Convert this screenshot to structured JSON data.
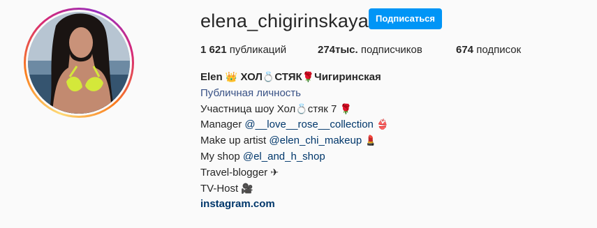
{
  "profile": {
    "username": "elena_chigirinskaya",
    "follow_label": "Подписаться"
  },
  "stats": {
    "posts_count": "1 621",
    "posts_label": " публикаций",
    "followers_count": "274тыс.",
    "followers_label": " подписчиков",
    "following_count": "674",
    "following_label": " подписок"
  },
  "bio": {
    "name_prefix": "Elen ",
    "name_emoji_1": "👑",
    "name_mid_1": " ХОЛ",
    "name_emoji_2": "💍",
    "name_mid_2": "СТЯК",
    "name_emoji_3": "🌹",
    "name_suffix": "Чигиринская",
    "category": "Публичная личность",
    "line1_text": "Участница шоу Хол",
    "line1_emoji_1": "💍",
    "line1_text_2": "стяк 7 ",
    "line1_emoji_2": "🌹",
    "line2_text": "Manager ",
    "line2_mention": "@__love__rose__collection",
    "line2_emoji": "👙",
    "line3_text": "Make up artist ",
    "line3_mention": "@elen_chi_makeup",
    "line3_emoji": "💄",
    "line4_text": "My shop ",
    "line4_mention": "@el_and_h_shop",
    "line5_text": "Travel-blogger ",
    "line5_emoji": "✈",
    "line6_text": "TV-Host ",
    "line6_emoji": "🎥",
    "website": "instagram.com"
  },
  "colors": {
    "follow_button_bg": "#0095f6",
    "link_color": "#00376b"
  }
}
